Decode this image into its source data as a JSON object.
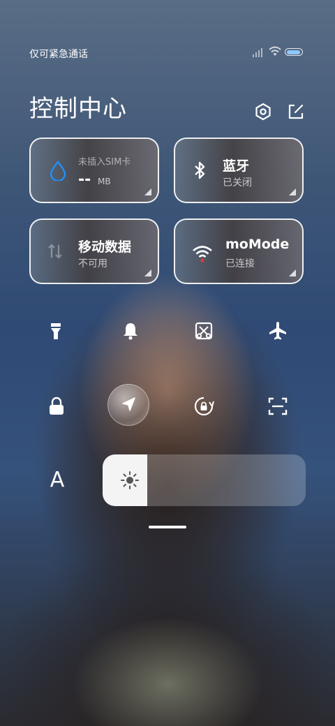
{
  "status_bar": {
    "carrier_text": "仅可紧急通话",
    "icons": [
      "cellular-signal-icon",
      "wifi-icon",
      "battery-icon"
    ]
  },
  "header": {
    "title": "控制中心",
    "settings_icon": "settings-hexagon-icon",
    "edit_icon": "edit-icon"
  },
  "tiles": [
    {
      "id": "data-usage",
      "label": "未插入SIM卡",
      "value": "--",
      "unit": "MB",
      "icon": "water-drop-icon",
      "accent": "#1e90ff"
    },
    {
      "id": "bluetooth",
      "label": "蓝牙",
      "sub": "已关闭",
      "icon": "bluetooth-icon"
    },
    {
      "id": "mobile-data",
      "label": "移动数据",
      "sub": "不可用",
      "icon": "mobile-data-icon"
    },
    {
      "id": "wifi",
      "label": "moMode",
      "sub": "已连接",
      "icon": "wifi-icon",
      "accent": "#e53935"
    }
  ],
  "toggles_row1": [
    "flashlight-icon",
    "bell-icon",
    "screenshot-icon",
    "airplane-icon"
  ],
  "toggles_row2": [
    "lock-icon",
    "location-icon",
    "rotation-lock-icon",
    "scanner-icon"
  ],
  "font_size_label": "A",
  "brightness": {
    "icon": "brightness-sun-icon",
    "level": 0.22
  }
}
